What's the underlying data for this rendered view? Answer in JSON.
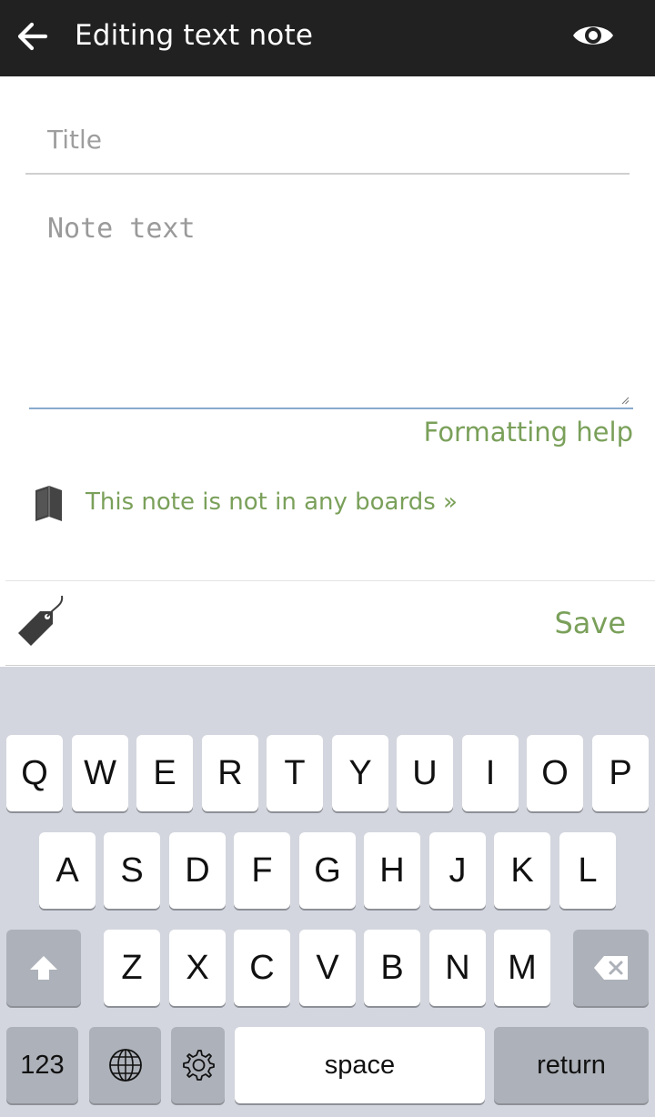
{
  "app_bar": {
    "title": "Editing text note",
    "back_icon": "arrow-left-icon",
    "preview_icon": "eye-icon"
  },
  "form": {
    "title_placeholder": "Title",
    "title_value": "",
    "note_placeholder": "Note text",
    "note_value": "",
    "formatting_help": "Formatting help"
  },
  "boards": {
    "icon": "book-icon",
    "text": "This note is not in any boards »"
  },
  "bottom_bar": {
    "tag_icon": "tag-icon",
    "save_label": "Save"
  },
  "keyboard": {
    "row1": [
      "Q",
      "W",
      "E",
      "R",
      "T",
      "Y",
      "U",
      "I",
      "O",
      "P"
    ],
    "row2": [
      "A",
      "S",
      "D",
      "F",
      "G",
      "H",
      "J",
      "K",
      "L"
    ],
    "row3": [
      "Z",
      "X",
      "C",
      "V",
      "B",
      "N",
      "M"
    ],
    "numbers_label": "123",
    "space_label": "space",
    "return_label": "return",
    "shift_icon": "shift-arrow-icon",
    "backspace_icon": "backspace-icon",
    "globe_icon": "globe-icon",
    "settings_icon": "gear-icon"
  },
  "colors": {
    "app_bar_bg": "#212121",
    "accent_green": "#7aa05a",
    "keyboard_bg": "#d3d6de",
    "special_key_bg": "#adb1b9"
  }
}
